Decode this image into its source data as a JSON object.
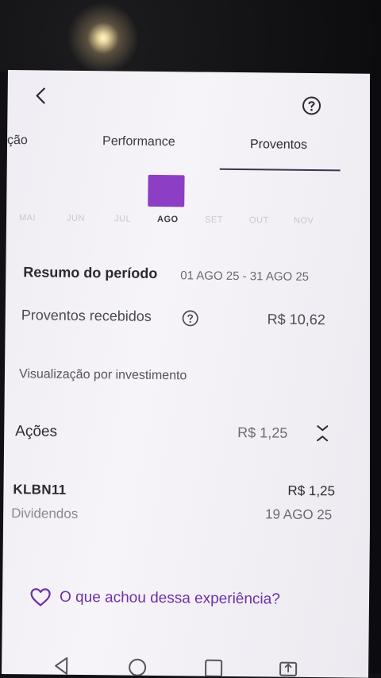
{
  "tabs": [
    {
      "label": "ção"
    },
    {
      "label": "Performance"
    },
    {
      "label": "Proventos"
    }
  ],
  "active_tab": "Proventos",
  "months": [
    "MAI",
    "JUN",
    "JUL",
    "AGO",
    "SET",
    "OUT",
    "NOV"
  ],
  "selected_month": "AGO",
  "accent_color": "#8c3fc4",
  "summary": {
    "title": "Resumo do período",
    "period": "01 AGO 25 - 31 AGO 25",
    "received_label": "Proventos recebidos",
    "received_value": "R$ 10,62"
  },
  "visualization_label": "Visualização por investimento",
  "group": {
    "name": "Ações",
    "value": "R$ 1,25"
  },
  "asset": {
    "ticker": "KLBN11",
    "type": "Dividendos",
    "value": "R$ 1,25",
    "date": "19 AGO 25"
  },
  "feedback_text": "O que achou dessa experiência?",
  "icons": {
    "back": "chevron-left-icon",
    "help": "question-circle-icon",
    "collapse": "chevrons-collapse-icon",
    "heart": "heart-outline-icon"
  }
}
